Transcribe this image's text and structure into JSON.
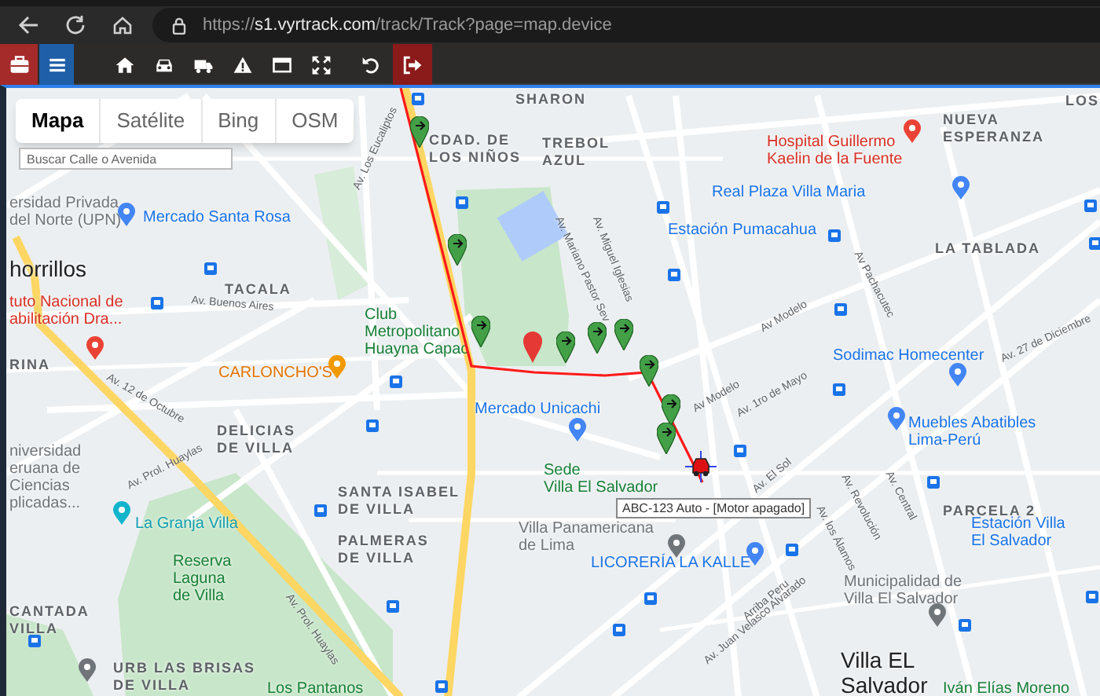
{
  "browser": {
    "url_scheme": "https://",
    "url_host": "s1.vyrtrack.com",
    "url_path": "/track/Track?page=map.device"
  },
  "toolbar": [
    {
      "kind": "briefcase"
    },
    {
      "kind": "menu"
    },
    {
      "kind": "home"
    },
    {
      "kind": "car"
    },
    {
      "kind": "truck"
    },
    {
      "kind": "warning"
    },
    {
      "kind": "window"
    },
    {
      "kind": "expand"
    },
    {
      "kind": "undo"
    },
    {
      "kind": "sign-out"
    }
  ],
  "map_types": [
    {
      "label": "Mapa",
      "selected": true
    },
    {
      "label": "Satélite",
      "selected": false
    },
    {
      "label": "Bing",
      "selected": false
    },
    {
      "label": "OSM",
      "selected": false
    }
  ],
  "search": {
    "placeholder": "Buscar Calle o Avenida"
  },
  "map_labels": [
    {
      "text": "SHARON",
      "kind": "district"
    },
    {
      "text": "CDAD. DE\nLOS NIÑOS",
      "kind": "district"
    },
    {
      "text": "TREBOL\nAZUL",
      "kind": "district"
    },
    {
      "text": "NUEVA\nESPERANZA",
      "kind": "district"
    },
    {
      "text": "LOS",
      "kind": "district"
    },
    {
      "text": "Hospital Guillermo\nKaelin de la Fuente",
      "kind": "hospital"
    },
    {
      "text": "ersidad Privada\ndel Norte (UPN)",
      "kind": "place"
    },
    {
      "text": "Mercado Santa Rosa",
      "kind": "shop"
    },
    {
      "text": "Real Plaza Villa Maria",
      "kind": "shop"
    },
    {
      "text": "Estación Pumacahua",
      "kind": "shop"
    },
    {
      "text": "LA TABLADA",
      "kind": "district"
    },
    {
      "text": "horrillos",
      "kind": "city"
    },
    {
      "text": "TACALA",
      "kind": "district"
    },
    {
      "text": "Av. Buenos Aires",
      "kind": "street"
    },
    {
      "text": "tuto Nacional de\nabilitación Dra...",
      "kind": "hospital"
    },
    {
      "text": "RINA",
      "kind": "district"
    },
    {
      "text": "CARLONCHO'S",
      "kind": "food"
    },
    {
      "text": "Club\nMetropolitano\nHuayna Capac",
      "kind": "park"
    },
    {
      "text": "Mercado Unicachi",
      "kind": "shop"
    },
    {
      "text": "Sodimac Homecenter",
      "kind": "shop"
    },
    {
      "text": "Av. 27 de Diciembre",
      "kind": "street"
    },
    {
      "text": "DELICIAS\nDE VILLA",
      "kind": "district"
    },
    {
      "text": "Muebles Abatibles\nLima-Perú",
      "kind": "shop"
    },
    {
      "text": "niversidad\neruana de\nCiencias\nplicadas...",
      "kind": "place"
    },
    {
      "text": "La Granja Villa",
      "kind": "attraction"
    },
    {
      "text": "SANTA ISABEL\nDE VILLA",
      "kind": "district"
    },
    {
      "text": "PALMERAS\nDE VILLA",
      "kind": "district"
    },
    {
      "text": "Reserva\nLaguna\nde Villa",
      "kind": "park"
    },
    {
      "text": "CANTADA\nVILLA",
      "kind": "district"
    },
    {
      "text": "URB LAS BRISAS\nDE VILLA",
      "kind": "district"
    },
    {
      "text": "Los Pantanos",
      "kind": "park"
    },
    {
      "text": "Sede\nVilla El Salvador",
      "kind": "park"
    },
    {
      "text": "Villa Panamericana\nde Lima",
      "kind": "place"
    },
    {
      "text": "PARCELA 2",
      "kind": "district"
    },
    {
      "text": "Estación Villa\nEl Salvador",
      "kind": "shop"
    },
    {
      "text": "LICORERÍA LA KALLE",
      "kind": "shop"
    },
    {
      "text": "Municipalidad de\nVilla El Salvador",
      "kind": "place"
    },
    {
      "text": "Villa EL\nSalvador",
      "kind": "city"
    },
    {
      "text": "Iván Elías Moreno",
      "kind": "park"
    },
    {
      "text": "Av. Miguel Iglesias",
      "kind": "street"
    },
    {
      "text": "Av. Mariano Pastor Sev",
      "kind": "street"
    },
    {
      "text": "Av Modelo",
      "kind": "street"
    },
    {
      "text": "Av Modelo",
      "kind": "street"
    },
    {
      "text": "Av. 1ro de Mayo",
      "kind": "street"
    },
    {
      "text": "Av Pachacutec",
      "kind": "street"
    },
    {
      "text": "Av. Prol. Huaylas",
      "kind": "street"
    },
    {
      "text": "Av. Prol. Huaylas",
      "kind": "street"
    },
    {
      "text": "Av. 12 de Octubre",
      "kind": "street"
    },
    {
      "text": "Av. El Sol",
      "kind": "street"
    },
    {
      "text": "Arriba Peru",
      "kind": "street"
    },
    {
      "text": "Av. Juan Velasco Alvarado",
      "kind": "street"
    },
    {
      "text": "Av. Revolución",
      "kind": "street"
    },
    {
      "text": "Av. los Álamos",
      "kind": "street"
    },
    {
      "text": "Av. Central",
      "kind": "street"
    },
    {
      "text": "Av. Los Eucaliptos",
      "kind": "street"
    }
  ],
  "vehicle": {
    "label": "ABC-123 Auto - [Motor apagado]"
  }
}
